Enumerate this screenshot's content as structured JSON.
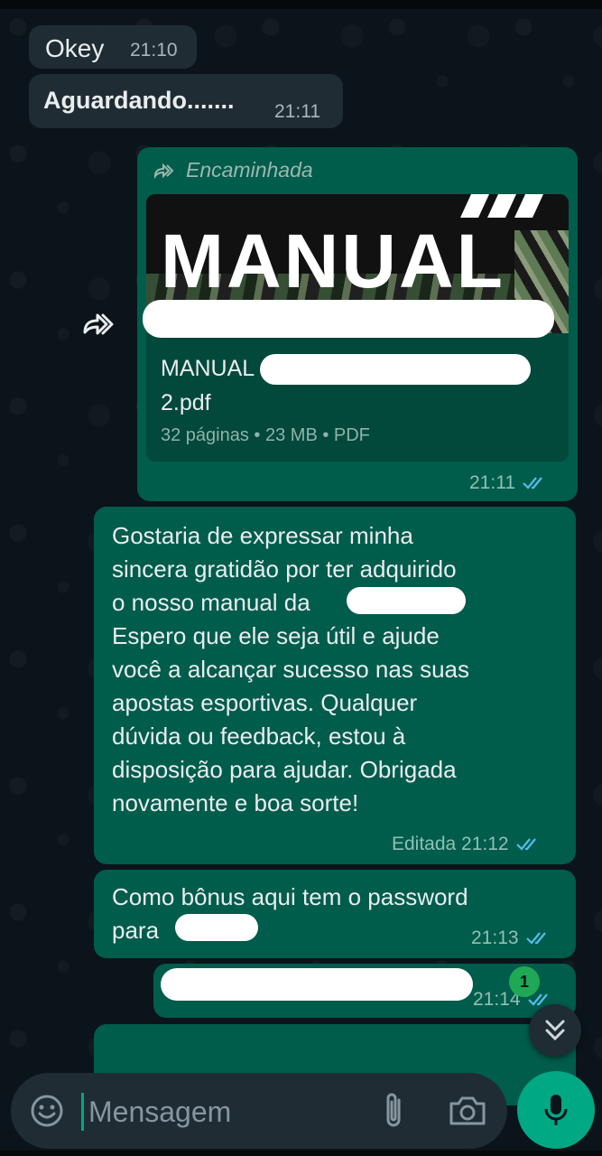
{
  "messages": {
    "in1": {
      "text": "Okey",
      "time": "21:10"
    },
    "in2": {
      "text": "Aguardando.......",
      "time": "21:11"
    },
    "doc": {
      "forwarded_label": "Encaminhada",
      "thumb_title": "MANUAL",
      "file_name_line1": "MANUAL",
      "file_name_line2": "2.pdf",
      "meta": "32 páginas • 23 MB • PDF",
      "time": "21:11"
    },
    "long": {
      "text": "Gostaria de expressar minha\nsincera gratidão por ter adquirido\no nosso manual da\nEspero que ele seja útil e ajude\nvocê a alcançar sucesso nas suas\napostas esportivas. Qualquer\ndúvida ou feedback, estou à\ndisposição para ajudar. Obrigada\nnovamente e boa sorte!",
      "time": "Editada 21:12"
    },
    "bonus": {
      "line1": "Como bônus aqui tem o password",
      "line2": "para",
      "time": "21:13"
    },
    "pass": {
      "time": "21:14",
      "unread": "1"
    }
  },
  "composer": {
    "placeholder": "Mensagem"
  },
  "icons": {
    "forward": "forward-icon",
    "ticks": "double-check-icon",
    "scroll": "chevrons-down-icon",
    "emoji": "emoji-icon",
    "attach": "paperclip-icon",
    "camera": "camera-icon",
    "mic": "microphone-icon"
  },
  "colors": {
    "background": "#0b141a",
    "incoming_bubble": "#202c33",
    "outgoing_bubble": "#005c4b",
    "accent": "#00a884",
    "read_ticks": "#53bdeb"
  }
}
